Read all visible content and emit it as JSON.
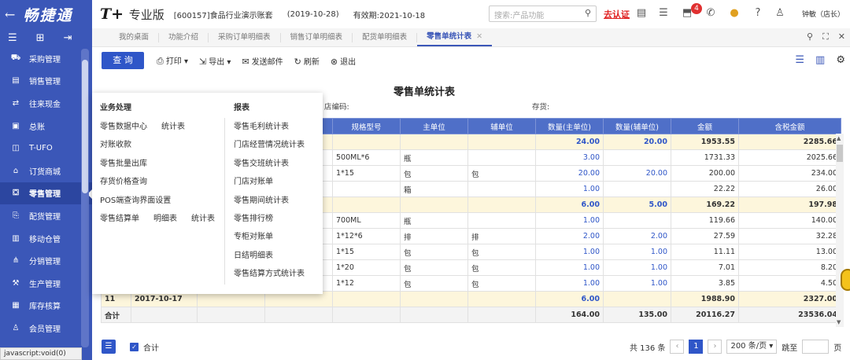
{
  "sidebar": {
    "back_icon": "back-arrow-icon",
    "logo": "畅捷通",
    "tools": [
      "menu-icon",
      "grid-icon",
      "pin-icon"
    ],
    "items": [
      {
        "label": "采购管理",
        "icon": "purchase-icon"
      },
      {
        "label": "销售管理",
        "icon": "sales-icon"
      },
      {
        "label": "往来现金",
        "icon": "cash-icon"
      },
      {
        "label": "总账",
        "icon": "ledger-icon"
      },
      {
        "label": "T-UFO",
        "icon": "ufo-icon"
      },
      {
        "label": "订货商城",
        "icon": "shop-icon"
      },
      {
        "label": "零售管理",
        "icon": "retail-icon",
        "active": true
      },
      {
        "label": "配货管理",
        "icon": "distribution-icon"
      },
      {
        "label": "移动仓管",
        "icon": "mobile-warehouse-icon"
      },
      {
        "label": "分销管理",
        "icon": "resale-icon"
      },
      {
        "label": "生产管理",
        "icon": "production-icon"
      },
      {
        "label": "库存核算",
        "icon": "inventory-icon"
      },
      {
        "label": "会员管理",
        "icon": "member-icon"
      }
    ],
    "status": "javascript:void(0)"
  },
  "topbar": {
    "brand": "T+",
    "edition": "专业版",
    "account": "[600157]食品行业演示账套",
    "date": "(2019-10-28)",
    "validity": "有效期:2021-10-18",
    "search_placeholder": "搜索:产品功能",
    "certify": "去认证",
    "badge": "4",
    "user": "钟敏（店长）"
  },
  "tabs": [
    {
      "label": "我的桌面"
    },
    {
      "label": "功能介绍"
    },
    {
      "label": "采购订单明细表"
    },
    {
      "label": "销售订单明细表"
    },
    {
      "label": "配货单明细表"
    },
    {
      "label": "零售单统计表",
      "active": true
    }
  ],
  "toolbar": {
    "query": "查 询",
    "print": "打印",
    "export": "导出",
    "email": "发送邮件",
    "refresh": "刷新",
    "exit": "退出"
  },
  "report": {
    "title": "零售单统计表",
    "filter_store": "店编码:",
    "filter_stock": "存货:"
  },
  "columns": [
    "规格型号",
    "主单位",
    "辅单位",
    "数量(主单位)",
    "数量(辅单位)",
    "金额",
    "含税金额"
  ],
  "rows": [
    {
      "type": "sub",
      "spec": "",
      "unit": "",
      "aux": "",
      "q1": "24.00",
      "q2": "20.00",
      "amt": "1953.55",
      "tax": "2285.66"
    },
    {
      "spec": "500ML*6",
      "unit": "瓶",
      "aux": "",
      "q1": "3.00",
      "q2": "",
      "amt": "1731.33",
      "tax": "2025.66"
    },
    {
      "spec": "1*15",
      "unit": "包",
      "aux": "包",
      "q1": "20.00",
      "q2": "20.00",
      "amt": "200.00",
      "tax": "234.00"
    },
    {
      "spec": "",
      "unit": "箱",
      "aux": "",
      "q1": "1.00",
      "q2": "",
      "amt": "22.22",
      "tax": "26.00"
    },
    {
      "type": "sub",
      "spec": "",
      "unit": "",
      "aux": "",
      "q1": "6.00",
      "q2": "5.00",
      "amt": "169.22",
      "tax": "197.98"
    },
    {
      "spec": "700ML",
      "unit": "瓶",
      "aux": "",
      "q1": "1.00",
      "q2": "",
      "amt": "119.66",
      "tax": "140.00"
    },
    {
      "spec": "1*12*6",
      "unit": "排",
      "aux": "排",
      "q1": "2.00",
      "q2": "2.00",
      "amt": "27.59",
      "tax": "32.28"
    },
    {
      "spec": "1*15",
      "unit": "包",
      "aux": "包",
      "q1": "1.00",
      "q2": "1.00",
      "amt": "11.11",
      "tax": "13.00"
    },
    {
      "spec": "1*20",
      "unit": "包",
      "aux": "包",
      "q1": "1.00",
      "q2": "1.00",
      "amt": "7.01",
      "tax": "8.20"
    },
    {
      "spec": "1*12",
      "unit": "包",
      "aux": "包",
      "q1": "1.00",
      "q2": "1.00",
      "amt": "3.85",
      "tax": "4.50"
    },
    {
      "type": "sub",
      "no": "11",
      "date": "2017-10-17",
      "spec": "",
      "unit": "",
      "aux": "",
      "q1": "6.00",
      "q2": "",
      "amt": "1988.90",
      "tax": "2327.00"
    }
  ],
  "total": {
    "label": "合计",
    "q1": "164.00",
    "q2": "135.00",
    "amt": "20116.27",
    "tax": "23536.04"
  },
  "dropdown": {
    "col1_title": "业务处理",
    "col2_title": "报表",
    "col1": [
      [
        "零售数据中心",
        "统计表"
      ],
      [
        "对账收款"
      ],
      [
        "零售批量出库"
      ],
      [
        "存货价格查询"
      ],
      [
        "POS端查询界面设置"
      ],
      [
        "零售结算单",
        "明细表",
        "统计表"
      ]
    ],
    "col2": [
      "零售毛利统计表",
      "门店经营情况统计表",
      "零售交班统计表",
      "门店对账单",
      "零售期间统计表",
      "零售排行榜",
      "专柜对账单",
      "日结明细表",
      "零售结算方式统计表"
    ]
  },
  "footer": {
    "checkbox_label": "合计",
    "total_records": "共 136 条",
    "current_page": "1",
    "page_size": "200 条/页",
    "goto": "跳至",
    "page_unit": "页"
  }
}
